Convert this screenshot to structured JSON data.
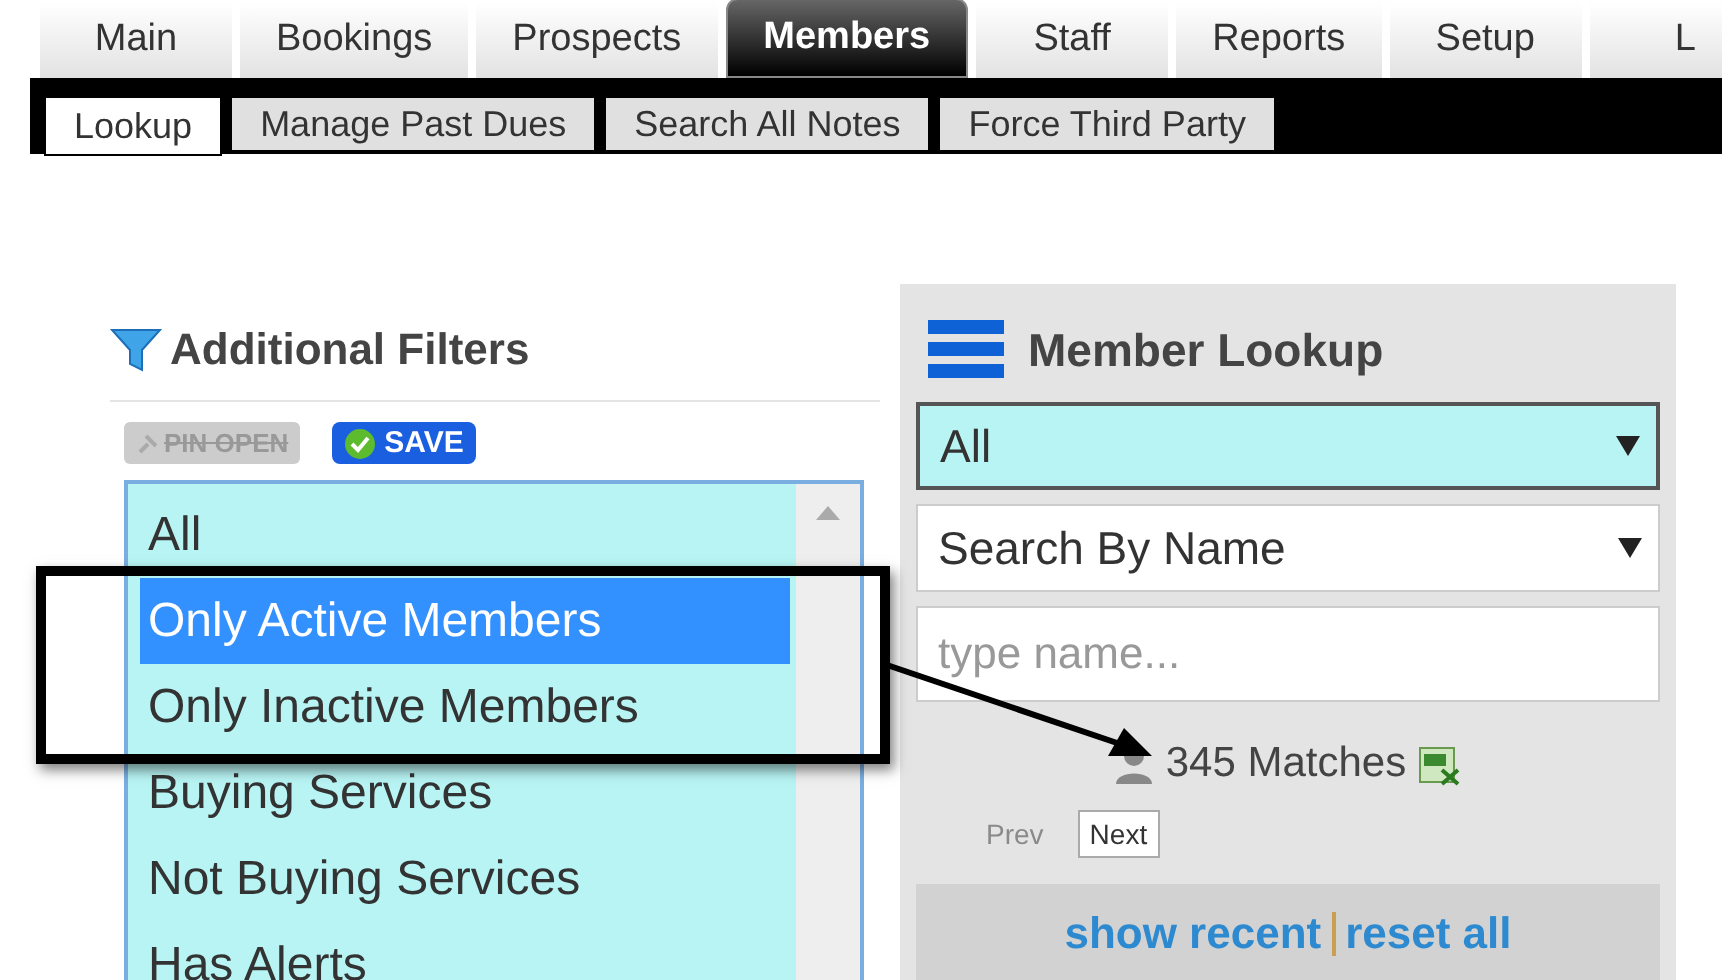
{
  "main_tabs": [
    {
      "label": "Main",
      "selected": false
    },
    {
      "label": "Bookings",
      "selected": false
    },
    {
      "label": "Prospects",
      "selected": false
    },
    {
      "label": "Members",
      "selected": true
    },
    {
      "label": "Staff",
      "selected": false
    },
    {
      "label": "Reports",
      "selected": false
    },
    {
      "label": "Setup",
      "selected": false
    },
    {
      "label": "L",
      "selected": false
    }
  ],
  "sub_tabs": [
    {
      "label": "Lookup",
      "selected": true
    },
    {
      "label": "Manage Past Dues",
      "selected": false
    },
    {
      "label": "Search All Notes",
      "selected": false
    },
    {
      "label": "Force Third Party",
      "selected": false
    }
  ],
  "filters": {
    "title": "Additional Filters",
    "pin_button": {
      "label": "PIN OPEN",
      "disabled": true
    },
    "save_button": "SAVE",
    "options": [
      {
        "label": "All",
        "selected": false
      },
      {
        "label": "Only Active Members",
        "selected": true
      },
      {
        "label": "Only Inactive Members",
        "selected": false
      },
      {
        "label": "Buying Services",
        "selected": false
      },
      {
        "label": "Not Buying Services",
        "selected": false
      },
      {
        "label": "Has Alerts",
        "selected": false
      }
    ]
  },
  "lookup": {
    "title": "Member Lookup",
    "status_select": "All",
    "search_by_select": "Search By Name",
    "name_field": {
      "placeholder": "type name..."
    },
    "matches": "345 Matches",
    "prev": {
      "label": "Prev",
      "disabled": true
    },
    "next": {
      "label": "Next",
      "disabled": false
    },
    "links": [
      "show recent",
      "reset all"
    ]
  }
}
